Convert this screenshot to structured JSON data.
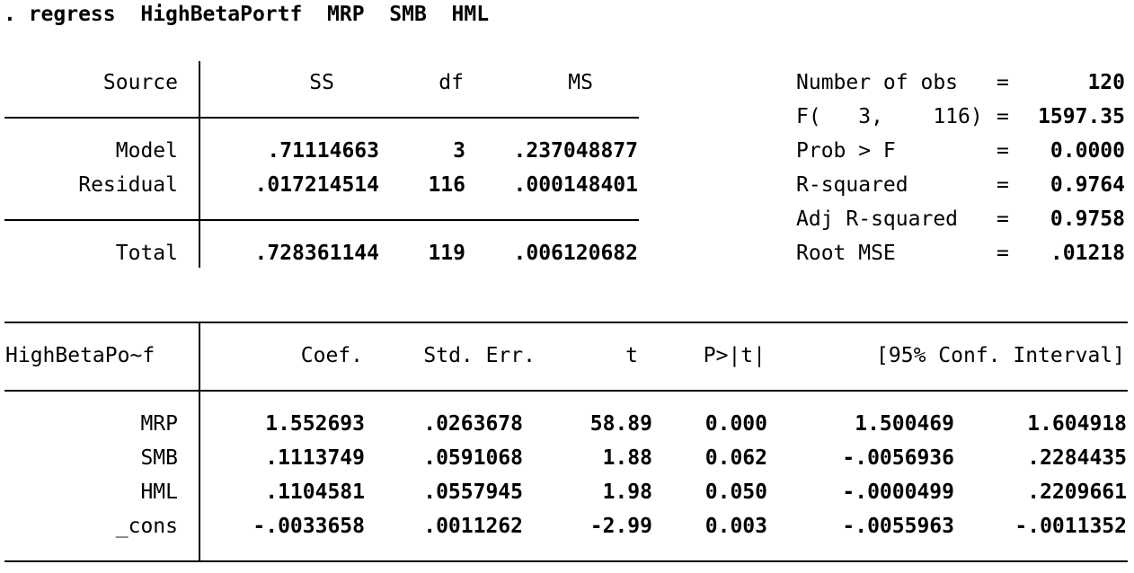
{
  "command": ". regress  HighBetaPortf  MRP  SMB  HML",
  "anova": {
    "headers": {
      "source": "Source",
      "ss": "SS",
      "df": "df",
      "ms": "MS"
    },
    "rows": [
      {
        "source": "Model",
        "ss": ".71114663",
        "df": "3",
        "ms": ".237048877"
      },
      {
        "source": "Residual",
        "ss": ".017214514",
        "df": "116",
        "ms": ".000148401"
      }
    ],
    "total": {
      "source": "Total",
      "ss": ".728361144",
      "df": "119",
      "ms": ".006120682"
    }
  },
  "stats": [
    {
      "label": "Number of obs",
      "eq": "=",
      "value": "120"
    },
    {
      "label": "F(   3,    116)",
      "eq": "=",
      "value": "1597.35"
    },
    {
      "label": "Prob > F",
      "eq": "=",
      "value": "0.0000"
    },
    {
      "label": "R-squared",
      "eq": "=",
      "value": "0.9764"
    },
    {
      "label": "Adj R-squared",
      "eq": "=",
      "value": "0.9758"
    },
    {
      "label": "Root MSE",
      "eq": "=",
      "value": ".01218"
    }
  ],
  "coef": {
    "headers": {
      "depvar": "HighBetaPo~f",
      "coef": "Coef.",
      "se": "Std. Err.",
      "t": "t",
      "p": "P>|t|",
      "ci": "[95% Conf. Interval]"
    },
    "rows": [
      {
        "name": "MRP",
        "coef": "1.552693",
        "se": ".0263678",
        "t": "58.89",
        "p": "0.000",
        "lo": "1.500469",
        "hi": "1.604918"
      },
      {
        "name": "SMB",
        "coef": ".1113749",
        "se": ".0591068",
        "t": "1.88",
        "p": "0.062",
        "lo": "-.0056936",
        "hi": ".2284435"
      },
      {
        "name": "HML",
        "coef": ".1104581",
        "se": ".0557945",
        "t": "1.98",
        "p": "0.050",
        "lo": "-.0000499",
        "hi": ".2209661"
      },
      {
        "name": "_cons",
        "coef": "-.0033658",
        "se": ".0011262",
        "t": "-2.99",
        "p": "0.003",
        "lo": "-.0055963",
        "hi": "-.0011352"
      }
    ]
  }
}
